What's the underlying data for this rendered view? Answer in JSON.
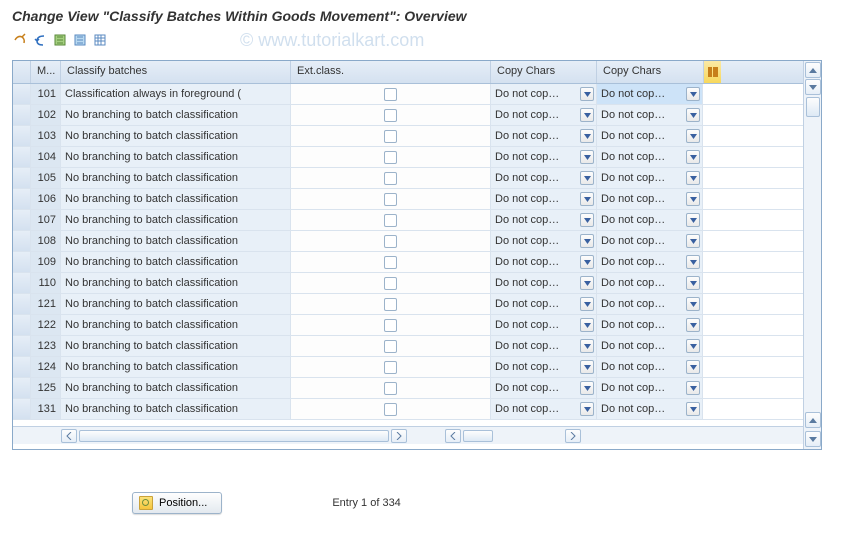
{
  "title": "Change View \"Classify Batches Within Goods Movement\": Overview",
  "watermark": "© www.tutorialkart.com",
  "columns": {
    "m": "M...",
    "classify": "Classify batches",
    "ext": "Ext.class.",
    "cc1": "Copy Chars",
    "cc2": "Copy Chars"
  },
  "rows": [
    {
      "m": "101",
      "cls": "Classification always in foreground (",
      "cc1": "Do not cop…",
      "cc2": "Do not cop…",
      "hl": true
    },
    {
      "m": "102",
      "cls": "No branching to batch classification",
      "cc1": "Do not cop…",
      "cc2": "Do not cop…"
    },
    {
      "m": "103",
      "cls": "No branching to batch classification",
      "cc1": "Do not cop…",
      "cc2": "Do not cop…"
    },
    {
      "m": "104",
      "cls": "No branching to batch classification",
      "cc1": "Do not cop…",
      "cc2": "Do not cop…"
    },
    {
      "m": "105",
      "cls": "No branching to batch classification",
      "cc1": "Do not cop…",
      "cc2": "Do not cop…"
    },
    {
      "m": "106",
      "cls": "No branching to batch classification",
      "cc1": "Do not cop…",
      "cc2": "Do not cop…"
    },
    {
      "m": "107",
      "cls": "No branching to batch classification",
      "cc1": "Do not cop…",
      "cc2": "Do not cop…"
    },
    {
      "m": "108",
      "cls": "No branching to batch classification",
      "cc1": "Do not cop…",
      "cc2": "Do not cop…"
    },
    {
      "m": "109",
      "cls": "No branching to batch classification",
      "cc1": "Do not cop…",
      "cc2": "Do not cop…"
    },
    {
      "m": "110",
      "cls": "No branching to batch classification",
      "cc1": "Do not cop…",
      "cc2": "Do not cop…"
    },
    {
      "m": "121",
      "cls": "No branching to batch classification",
      "cc1": "Do not cop…",
      "cc2": "Do not cop…"
    },
    {
      "m": "122",
      "cls": "No branching to batch classification",
      "cc1": "Do not cop…",
      "cc2": "Do not cop…"
    },
    {
      "m": "123",
      "cls": "No branching to batch classification",
      "cc1": "Do not cop…",
      "cc2": "Do not cop…"
    },
    {
      "m": "124",
      "cls": "No branching to batch classification",
      "cc1": "Do not cop…",
      "cc2": "Do not cop…"
    },
    {
      "m": "125",
      "cls": "No branching to batch classification",
      "cc1": "Do not cop…",
      "cc2": "Do not cop…"
    },
    {
      "m": "131",
      "cls": "No branching to batch classification",
      "cc1": "Do not cop…",
      "cc2": "Do not cop…"
    }
  ],
  "position_btn": "Position...",
  "entry_label": "Entry 1 of 334"
}
